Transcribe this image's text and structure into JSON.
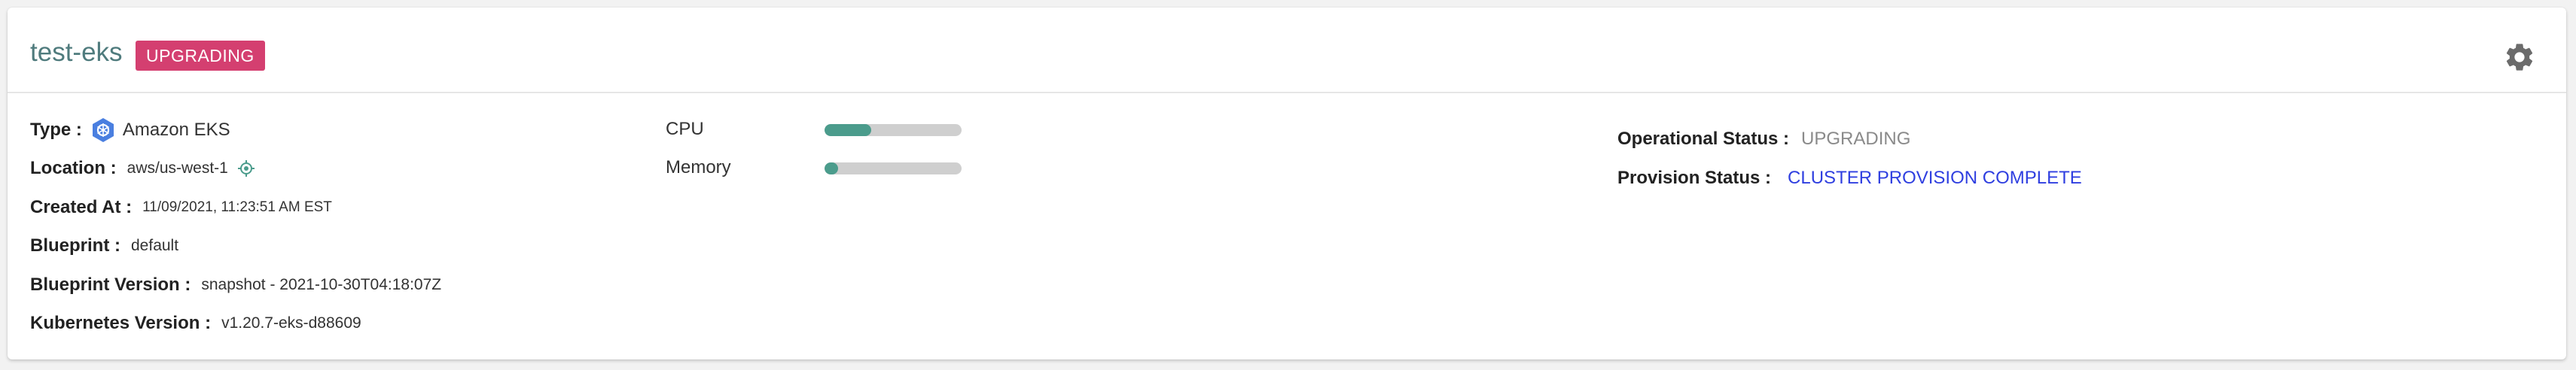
{
  "header": {
    "cluster_name": "test-eks",
    "status_badge": "UPGRADING",
    "colors": {
      "badge_bg": "#d43f70",
      "name": "#4f7b7d"
    },
    "settings_icon": "gear-icon"
  },
  "details": {
    "type": {
      "label": "Type :",
      "value": "Amazon EKS",
      "icon": "kubernetes-icon"
    },
    "location": {
      "label": "Location :",
      "value": "aws/us-west-1",
      "icon": "locate-icon"
    },
    "created_at": {
      "label": "Created At :",
      "value": "11/09/2021, 11:23:51 AM EST"
    },
    "blueprint": {
      "label": "Blueprint :",
      "value": "default"
    },
    "blueprint_version": {
      "label": "Blueprint Version :",
      "value": "snapshot - 2021-10-30T04:18:07Z"
    },
    "kubernetes_version": {
      "label": "Kubernetes Version :",
      "value": "v1.20.7-eks-d88609"
    }
  },
  "metrics": {
    "cpu": {
      "label": "CPU",
      "percent": 34
    },
    "memory": {
      "label": "Memory",
      "percent": 10
    },
    "bar_color": "#4b9c8c"
  },
  "status": {
    "operational": {
      "label": "Operational Status :",
      "value": "UPGRADING",
      "color": "#8a8a8a"
    },
    "provision": {
      "label": "Provision Status :",
      "value": "CLUSTER PROVISION COMPLETE",
      "color": "#2f3fe0"
    }
  }
}
